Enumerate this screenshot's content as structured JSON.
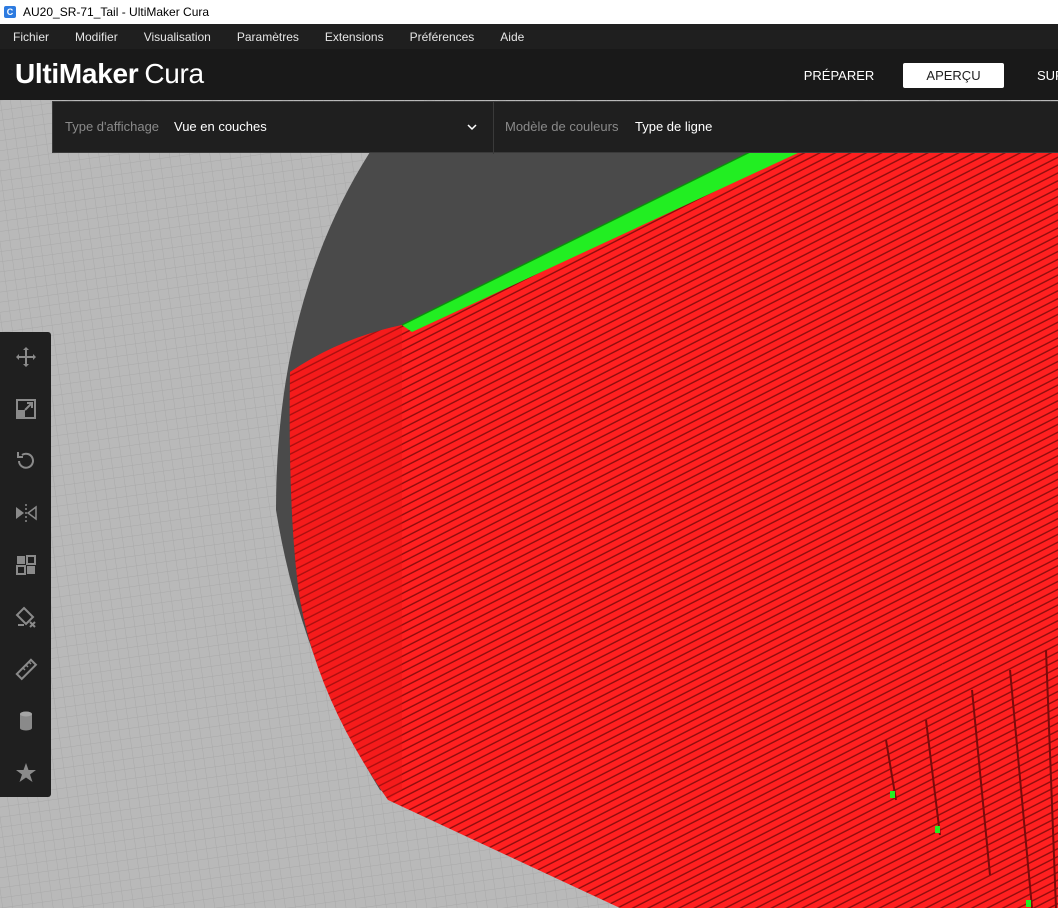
{
  "window": {
    "title": "AU20_SR-71_Tail - UltiMaker Cura",
    "app_icon_letter": "C"
  },
  "menubar": {
    "items": [
      "Fichier",
      "Modifier",
      "Visualisation",
      "Paramètres",
      "Extensions",
      "Préférences",
      "Aide"
    ]
  },
  "header": {
    "logo_bold": "UltiMaker",
    "logo_light": "Cura",
    "tabs": {
      "prepare": "PRÉPARER",
      "preview": "APERÇU",
      "monitor": "SUR"
    },
    "active_tab": "preview"
  },
  "view_panel": {
    "view_type_label": "Type d'affichage",
    "view_type_value": "Vue en couches",
    "color_scheme_label": "Modèle de couleurs",
    "color_scheme_value": "Type de ligne"
  },
  "toolbar": {
    "tools": [
      "move-icon",
      "scale-icon",
      "rotate-icon",
      "mirror-icon",
      "per-model-settings-icon",
      "support-blocker-icon",
      "measure-icon",
      "cylinder-icon",
      "star-icon"
    ]
  },
  "colors": {
    "accent": "#ffffff",
    "wall_red": "#ff1a1a",
    "skin_green": "#22ee22",
    "buildplate": "#4a4a4a",
    "grid_bg": "#b9b9b9"
  }
}
